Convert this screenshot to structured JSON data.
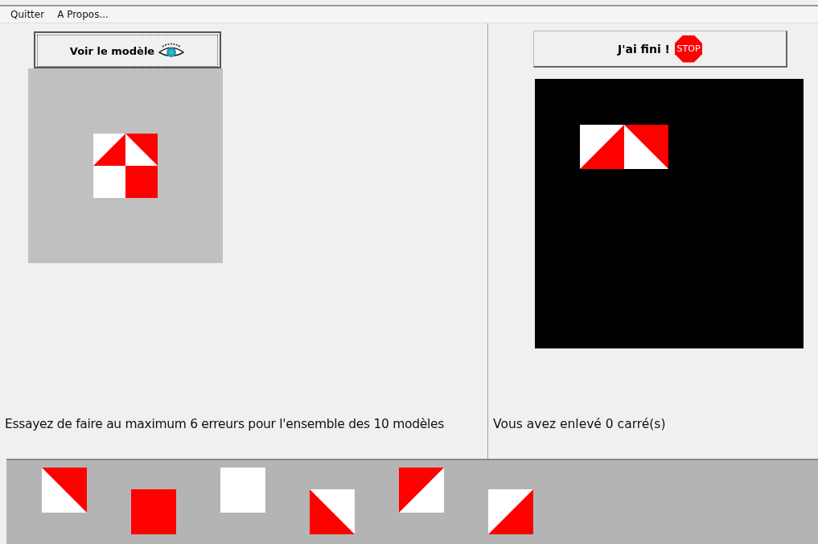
{
  "menu": [
    {
      "label": "Quitter"
    },
    {
      "label": "A Propos..."
    }
  ],
  "model_button": {
    "label": "Voir le modèle"
  },
  "model": {
    "rows": [
      [
        {
          "kind": "br"
        },
        {
          "kind": "tr"
        }
      ],
      [
        {
          "kind": "white"
        },
        {
          "kind": "red"
        }
      ]
    ]
  },
  "instruction": "Essayez de faire au maximum 6 erreurs pour l'ensemble des 10 modèles",
  "finish_button": {
    "label": "J'ai fini !",
    "sign": "STOP"
  },
  "board": {
    "rows": [
      [
        {
          "kind": "br"
        },
        {
          "kind": "tr"
        }
      ]
    ]
  },
  "status": "Vous avez enlevé 0 carré(s)",
  "palette": [
    {
      "kind": "tr"
    },
    {
      "kind": "red"
    },
    {
      "kind": "white"
    },
    {
      "kind": "bl"
    },
    {
      "kind": "tl"
    },
    {
      "kind": "br"
    }
  ]
}
